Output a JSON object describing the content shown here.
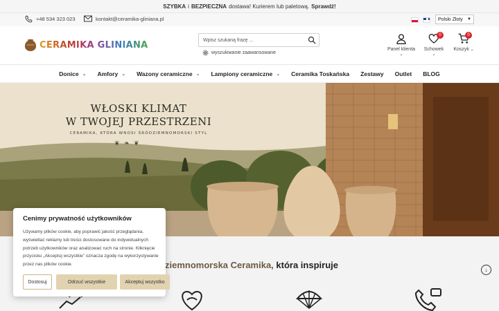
{
  "promo": {
    "part1": "SZYBKA",
    "part2": " i ",
    "part3": "BEZPIECZNA",
    "part4": " dostawa! Kurierem lub paletową.",
    "part5": "Sprawdź!"
  },
  "contact": {
    "phone": "+48 534 323 023",
    "email": "kontakt@ceramika-gliniana.pl",
    "currency": "Polski Złoty"
  },
  "header": {
    "logo_text": "CERAMIKA GLINIANA",
    "search_placeholder": "Wpisz szukaną frazę ...",
    "advanced_search": "wyszukiwanie zaawansowane",
    "account_label": "Panel klienta",
    "wishlist_label": "Schowek",
    "wishlist_count": "0",
    "cart_label": "Koszyk",
    "cart_count": "0"
  },
  "nav": [
    {
      "label": "Donice",
      "has_dropdown": true
    },
    {
      "label": "Amfory",
      "has_dropdown": true
    },
    {
      "label": "Wazony ceramiczne",
      "has_dropdown": true
    },
    {
      "label": "Lampiony ceramiczne",
      "has_dropdown": true
    },
    {
      "label": "Ceramika Toskańska",
      "has_dropdown": false
    },
    {
      "label": "Zestawy",
      "has_dropdown": false
    },
    {
      "label": "Outlet",
      "has_dropdown": false
    },
    {
      "label": "BLOG",
      "has_dropdown": false
    }
  ],
  "hero": {
    "title_line1": "WŁOSKI KLIMAT",
    "title_line2": "W TWOJEJ PRZESTRZENI",
    "subtitle": "CERAMIKA, KTÓRA WNOSI ŚRÓDZIEMNOMORSKI STYL"
  },
  "section": {
    "title_accent": "ziemnomorska Ceramika,",
    "title_rest": " która inspiruje"
  },
  "cookie": {
    "title": "Cenimy prywatność użytkowników",
    "body": "Używamy plików cookie, aby poprawić jakość przeglądania, wyświetlać reklamy lub treści dostosowane do indywidualnych potrzeb użytkowników oraz analizować ruch na stronie. Kliknięcie przycisku „Akceptuj wszystkie” oznacza zgodę na wykorzystywanie przez nas plików cookie.",
    "manage": "Dostosuj",
    "reject": "Odrzuć wszystkie",
    "accept": "Akceptuj wszystko"
  },
  "colors": {
    "accent_gold": "#e2d3b0",
    "badge_red": "#d9262c",
    "brown_text": "#6b5a44"
  }
}
